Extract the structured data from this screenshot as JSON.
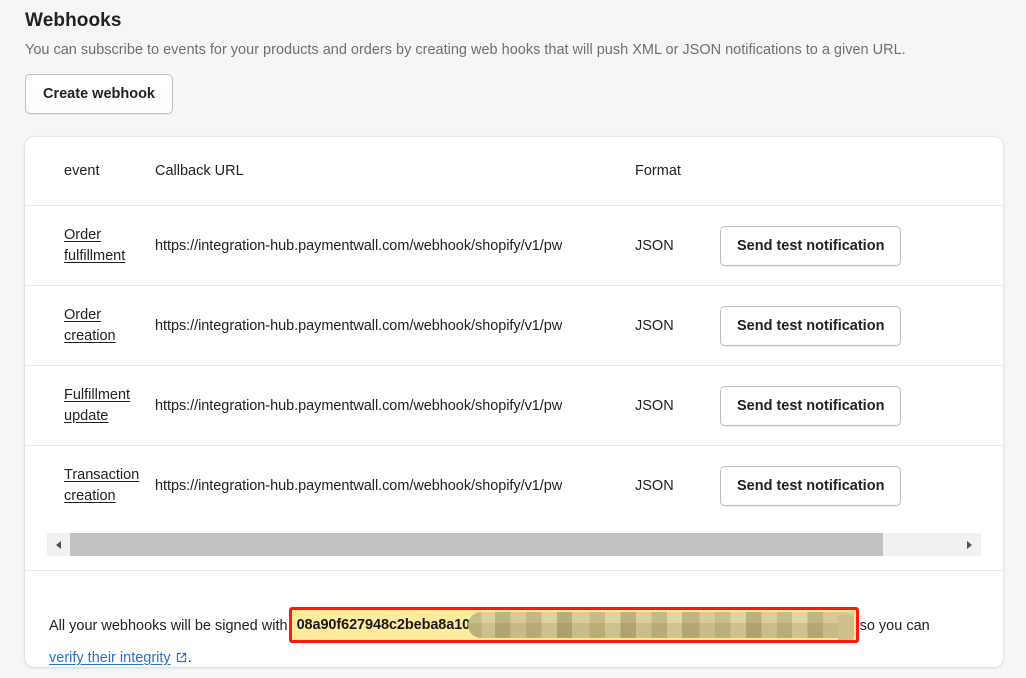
{
  "header": {
    "title": "Webhooks",
    "description": "You can subscribe to events for your products and orders by creating web hooks that will push XML or JSON notifications to a given URL.",
    "create_button": "Create webhook"
  },
  "table": {
    "columns": {
      "event": "event",
      "callback_url": "Callback URL",
      "format": "Format",
      "action": ""
    },
    "rows": [
      {
        "event_line1": "Order",
        "event_line2": "fulfillment",
        "callback_url": "https://integration-hub.paymentwall.com/webhook/shopify/v1/pw",
        "format": "JSON",
        "action_label": "Send test notification"
      },
      {
        "event_line1": "Order",
        "event_line2": "creation",
        "callback_url": "https://integration-hub.paymentwall.com/webhook/shopify/v1/pw",
        "format": "JSON",
        "action_label": "Send test notification"
      },
      {
        "event_line1": "Fulfillment",
        "event_line2": "update",
        "callback_url": "https://integration-hub.paymentwall.com/webhook/shopify/v1/pw",
        "format": "JSON",
        "action_label": "Send test notification"
      },
      {
        "event_line1": "Transaction",
        "event_line2": "creation",
        "callback_url": "https://integration-hub.paymentwall.com/webhook/shopify/v1/pw",
        "format": "JSON",
        "action_label": "Send test notification"
      }
    ]
  },
  "scrollbar": {
    "left_arrow": "left-arrow",
    "right_arrow": "right-arrow",
    "thumb_position_percent": 0
  },
  "footer": {
    "text_before": "All your webhooks will be signed with",
    "signature_visible": "08a90f627948c2beba8a10",
    "signature_redacted": true,
    "text_after": "so you can",
    "link_label": "verify their integrity",
    "external_icon": "external-link-icon",
    "period": "."
  },
  "colors": {
    "page_background": "#f6f6f7",
    "card_background": "#ffffff",
    "text_primary": "#202223",
    "text_subdued": "#6d7175",
    "link": "#2c6ecb",
    "highlight_background": "#ffeb9c",
    "highlight_border": "#ff1a0c",
    "divider": "#e8e9eb",
    "scrollbar_thumb": "#c1c1c1",
    "scrollbar_track": "#f1f1f1"
  }
}
